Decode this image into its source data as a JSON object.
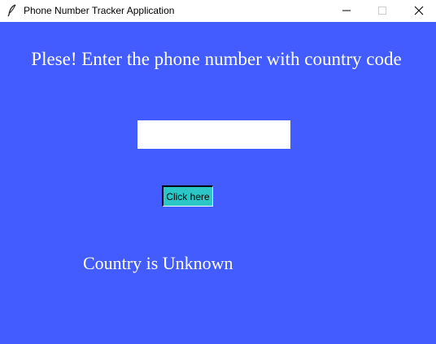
{
  "window": {
    "title": "Phone Number Tracker Application",
    "title_icon": "feather-icon",
    "controls": {
      "minimize_icon": "minimize-icon",
      "maximize_icon": "maximize-icon",
      "close_icon": "close-icon"
    }
  },
  "main": {
    "prompt": "Plese! Enter the phone number with country code",
    "phone_input": {
      "value": "",
      "placeholder": ""
    },
    "submit_button": {
      "label": "Click here"
    },
    "result": "Country is Unknown"
  },
  "colors": {
    "background": "#425cff",
    "button": "#2cc6c6",
    "text": "#ffffff"
  }
}
